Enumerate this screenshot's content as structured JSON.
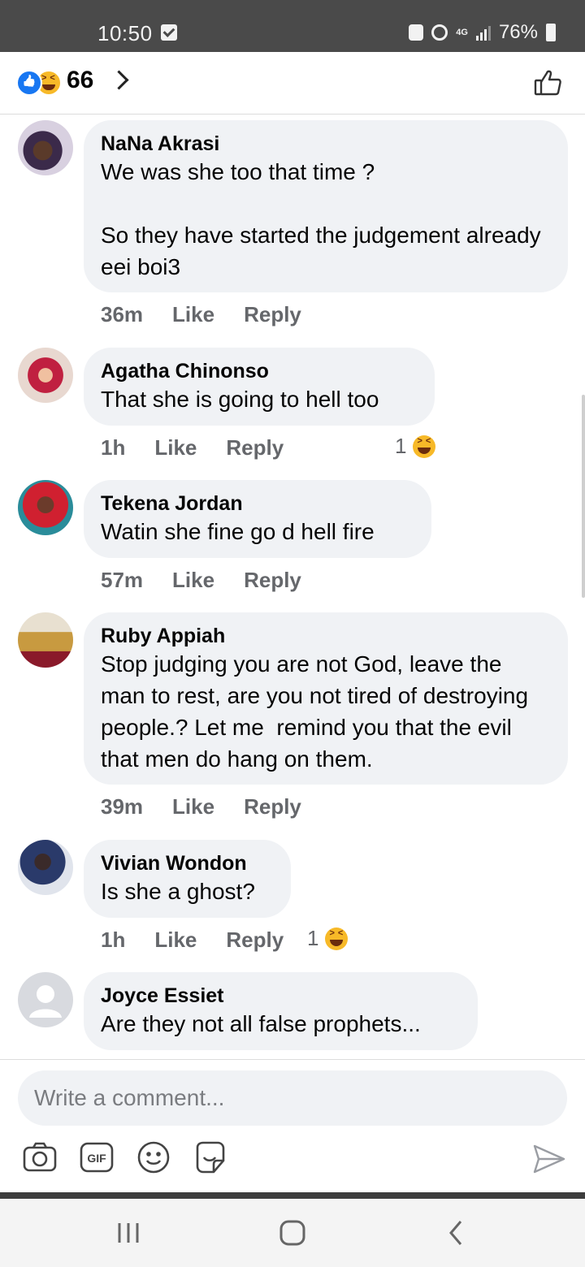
{
  "status_bar": {
    "time": "10:50",
    "network": "4G",
    "battery": "76%"
  },
  "reactions": {
    "count": "66",
    "icons": [
      "like-reaction-icon",
      "haha-reaction-icon"
    ]
  },
  "comments": [
    {
      "name": "NaNa Akrasi",
      "text": "We was she too that time ?\n\nSo they have started the judgement already eei boi3",
      "time": "36m",
      "like": "Like",
      "reply": "Reply"
    },
    {
      "name": "Agatha Chinonso",
      "text": "That she is going to hell too",
      "time": "1h",
      "like": "Like",
      "reply": "Reply",
      "reaction_count": "1"
    },
    {
      "name": "Tekena Jordan",
      "text": "Watin she fine go d hell fire",
      "time": "57m",
      "like": "Like",
      "reply": "Reply"
    },
    {
      "name": "Ruby Appiah",
      "text": "Stop judging you are not God, leave the man to rest, are you not tired of destroying people.? Let me  remind you that the evil that men do hang on them.",
      "time": "39m",
      "like": "Like",
      "reply": "Reply"
    },
    {
      "name": "Vivian Wondon",
      "text": "Is she a ghost?",
      "time": "1h",
      "like": "Like",
      "reply": "Reply",
      "reaction_count": "1"
    },
    {
      "name": "Joyce Essiet",
      "text": "Are they not all false prophets..."
    }
  ],
  "composer": {
    "placeholder": "Write a comment..."
  },
  "colors": {
    "bubble": "#f0f2f5",
    "like_blue": "#1877f2",
    "haha_yellow": "#f7b928",
    "meta_gray": "#65676b"
  }
}
